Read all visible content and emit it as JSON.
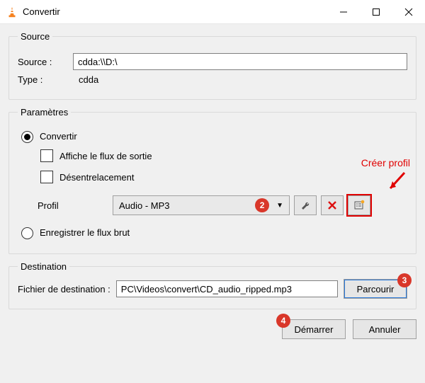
{
  "window": {
    "title": "Convertir"
  },
  "source": {
    "legend": "Source",
    "label": "Source :",
    "value": "cdda:\\\\D:\\",
    "type_label": "Type :",
    "type_value": "cdda"
  },
  "params": {
    "legend": "Paramètres",
    "convert_label": "Convertir",
    "show_output_label": "Affiche le flux de sortie",
    "deinterlace_label": "Désentrelacement",
    "profile_label": "Profil",
    "profile_value": "Audio - MP3",
    "save_raw_label": "Enregistrer le flux brut",
    "annot_create_profile": "Créer profil"
  },
  "destination": {
    "legend": "Destination",
    "label": "Fichier de destination :",
    "value": "PC\\Videos\\convert\\CD_audio_ripped.mp3",
    "browse_label": "Parcourir"
  },
  "footer": {
    "start_label": "Démarrer",
    "cancel_label": "Annuler"
  },
  "badges": {
    "b2": "2",
    "b3": "3",
    "b4": "4"
  }
}
